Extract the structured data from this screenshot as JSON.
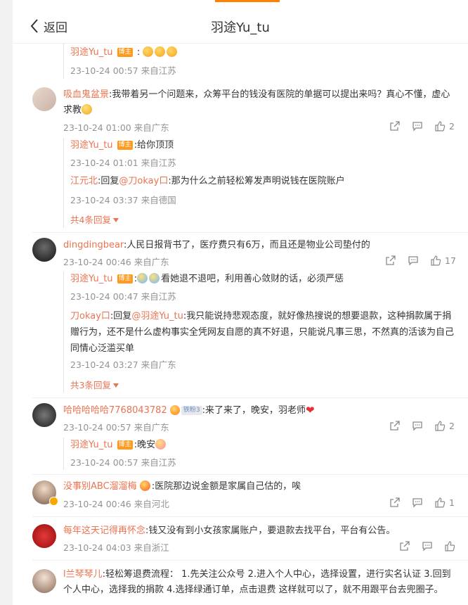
{
  "header": {
    "back_label": "返回",
    "title": "羽途Yu_tu"
  },
  "badges": {
    "blogger": "博主",
    "fan": "铁粉3"
  },
  "r0": {
    "name": "羽途Yu_tu",
    "colon": ":",
    "time": "23-10-24 00:57 来自江苏"
  },
  "c1": {
    "name": "吸血鬼盆景",
    "text": ":我带着另一个问题来，众筹平台的钱没有医院的单据可以提出来吗？真心不懂，虚心求教",
    "time": "23-10-24 01:00 来自广东",
    "likes": "2",
    "replies": [
      {
        "name": "羽途Yu_tu",
        "text": ":给你顶顶",
        "time": "23-10-24 01:01 来自江苏"
      },
      {
        "name": "江元北",
        "pre": ":回复",
        "mention": "@刀okay口",
        "text": ":那为什么之前轻松筹发声明说钱在医院账户",
        "time": "23-10-24 03:37 来自德国"
      }
    ],
    "more": "共4条回复"
  },
  "c2": {
    "name": "dingdingbear",
    "text": ":人民日报背书了，医疗费只有6万，而且还是物业公司垫付的",
    "time": "23-10-24 00:46 来自广东",
    "likes": "17",
    "replies": [
      {
        "name": "羽途Yu_tu",
        "text": "看她退不退吧，利用善心敛财的话，必须严惩",
        "time": "23-10-24 00:47 来自江苏"
      },
      {
        "name": "刀okay口",
        "pre": ":回复",
        "mention": "@羽途Yu_tu",
        "text": ":我只能说持悲观态度，就好像热搜说的想要退款，这种捐款属于捐赠行为，还不是什么虚构事实全凭网友自愿的真不好退，只能说凡事三思，不然真的活该为自己同情心泛滥买单",
        "time": "23-10-24 03:27 来自广东"
      }
    ],
    "more": "共3条回复"
  },
  "c3": {
    "name": "哈哈哈哈哈7768043782",
    "text": ":来了来了，晚安，羽老师",
    "time": "23-10-24 00:57 来自广东",
    "likes": "2",
    "replies": [
      {
        "name": "羽途Yu_tu",
        "text": ":晚安",
        "time": "23-10-24 00:57 来自江苏"
      }
    ]
  },
  "c4": {
    "name": "没事别ABC溜溜梅",
    "text": ":医院那边说金额是家属自己估的，唉",
    "time": "23-10-24 00:46 来自河北",
    "likes": "1"
  },
  "c5": {
    "name": "每年这天记得再怀念",
    "text": ":钱又没有到小女孩家属账户，要退款去找平台，平台有公告。",
    "time": "23-10-24 04:03 来自浙江"
  },
  "c6": {
    "name": "l兰琴琴儿",
    "text": ":轻松筹退费流程： 1.先关注公众号 2.进入个人中心，选择设置，进行实名认证 3.回到个人中心，选择我的捐款 4.选择绿通订单，点击退费 这样就可以了，就不用跟平台去兜圈子。"
  },
  "colors": {
    "accent": "#ff8200",
    "name": "#eb7350",
    "meta": "#939393"
  }
}
